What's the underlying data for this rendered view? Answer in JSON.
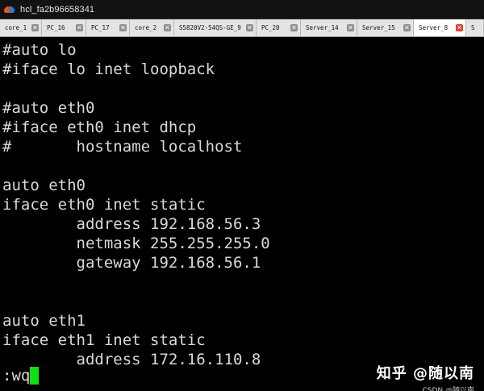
{
  "window": {
    "title": "hcl_fa2b96658341",
    "icon": "cloud-logo-icon"
  },
  "tabs": [
    {
      "label": "core_1",
      "active": false
    },
    {
      "label": "PC_16",
      "active": false
    },
    {
      "label": "PC_17",
      "active": false
    },
    {
      "label": "core_2",
      "active": false
    },
    {
      "label": "S5820V2-54QS-GE_9",
      "active": false
    },
    {
      "label": "PC_20",
      "active": false
    },
    {
      "label": "Server_14",
      "active": false
    },
    {
      "label": "Server_15",
      "active": false
    },
    {
      "label": "Server_8",
      "active": true
    },
    {
      "label": "S",
      "active": false
    }
  ],
  "terminal": {
    "lines": [
      "#auto lo",
      "#iface lo inet loopback",
      "",
      "#auto eth0",
      "#iface eth0 inet dhcp",
      "#       hostname localhost",
      "",
      "auto eth0",
      "iface eth0 inet static",
      "        address 192.168.56.3",
      "        netmask 255.255.255.0",
      "        gateway 192.168.56.1",
      "",
      "",
      "auto eth1",
      "iface eth1 inet static",
      "        address 172.16.110.8"
    ],
    "command": ":wq",
    "colors": {
      "background": "#000000",
      "text": "#d9d9d9",
      "cursor": "#10e010"
    }
  },
  "watermark": {
    "main": "知乎 @随以南",
    "sub": "CSDN @随以南"
  }
}
